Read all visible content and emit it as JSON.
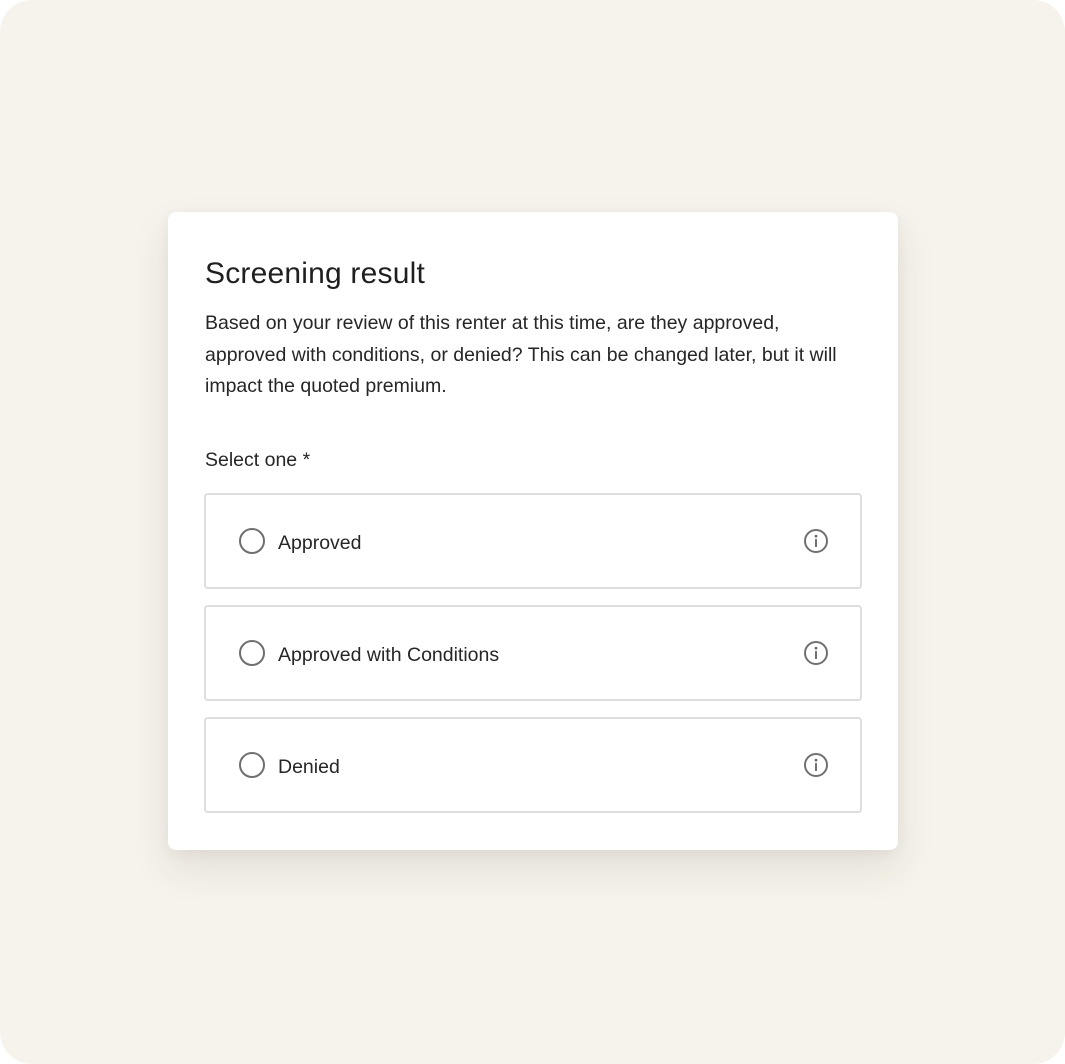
{
  "dialog": {
    "title": "Screening result",
    "description": "Based on your review of this renter at this time, are they approved, approved with conditions, or denied? This can be changed later, but it will impact the quoted premium.",
    "select_label": "Select one *"
  },
  "options": [
    {
      "label": "Approved",
      "selected": false,
      "icon": "info-icon"
    },
    {
      "label": "Approved with Conditions",
      "selected": false,
      "icon": "info-icon"
    },
    {
      "label": "Denied",
      "selected": false,
      "icon": "info-icon"
    }
  ],
  "colors": {
    "background": "#f6f3ec",
    "card": "#ffffff",
    "border": "#dedede",
    "text": "#262626",
    "icon": "#6f6f6f"
  }
}
